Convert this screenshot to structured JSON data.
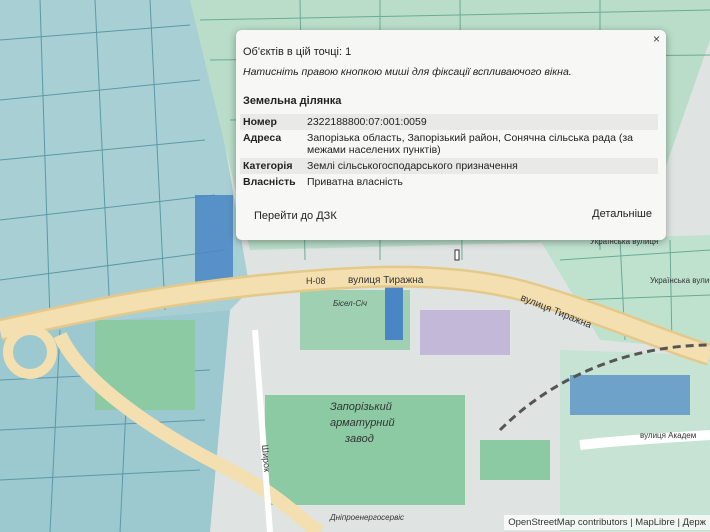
{
  "map_labels": {
    "road_code": "Н-08",
    "street_1": "вулиця Тиражна",
    "street_2": "вулиця Тиражна",
    "street_top_right": "Українська вулиця",
    "street_right": "Українська вулиця",
    "street_akadem": "вулиця Академ",
    "street_vertical": "Широк",
    "plant_line1": "Запорізький",
    "plant_line2": "арматурний",
    "plant_line3": "завод",
    "poi_small": "Бісел-Січ",
    "bottom_street": "Дніпроенергосервіс"
  },
  "popup": {
    "close": "×",
    "count": "Об'єктів в цій точці: 1",
    "hint": "Натисніть правою кнопкою миші для фіксації вспливаючого вікна.",
    "title": "Земельна ділянка",
    "rows": [
      {
        "key": "Номер",
        "value": "2322188800:07:001:0059"
      },
      {
        "key": "Адреса",
        "value": "Запорізька область, Запорізький район, Сонячна сільська рада (за межами населених пунктів)"
      },
      {
        "key": "Категорія",
        "value": "Землі сільськогосподарського призначення"
      },
      {
        "key": "Власність",
        "value": "Приватна власність"
      }
    ],
    "link_dzk": "Перейти до ДЗК",
    "link_more": "Детальніше"
  },
  "attribution": "OpenStreetMap contributors | MapLibre | Держ",
  "colors": {
    "parcel_fill": "#a8d3d8",
    "parcel_stroke": "#5a9aa8",
    "green_area": "#8ccaa4",
    "road": "#f0d9a3",
    "parcel_blue": "#4a86c4"
  }
}
